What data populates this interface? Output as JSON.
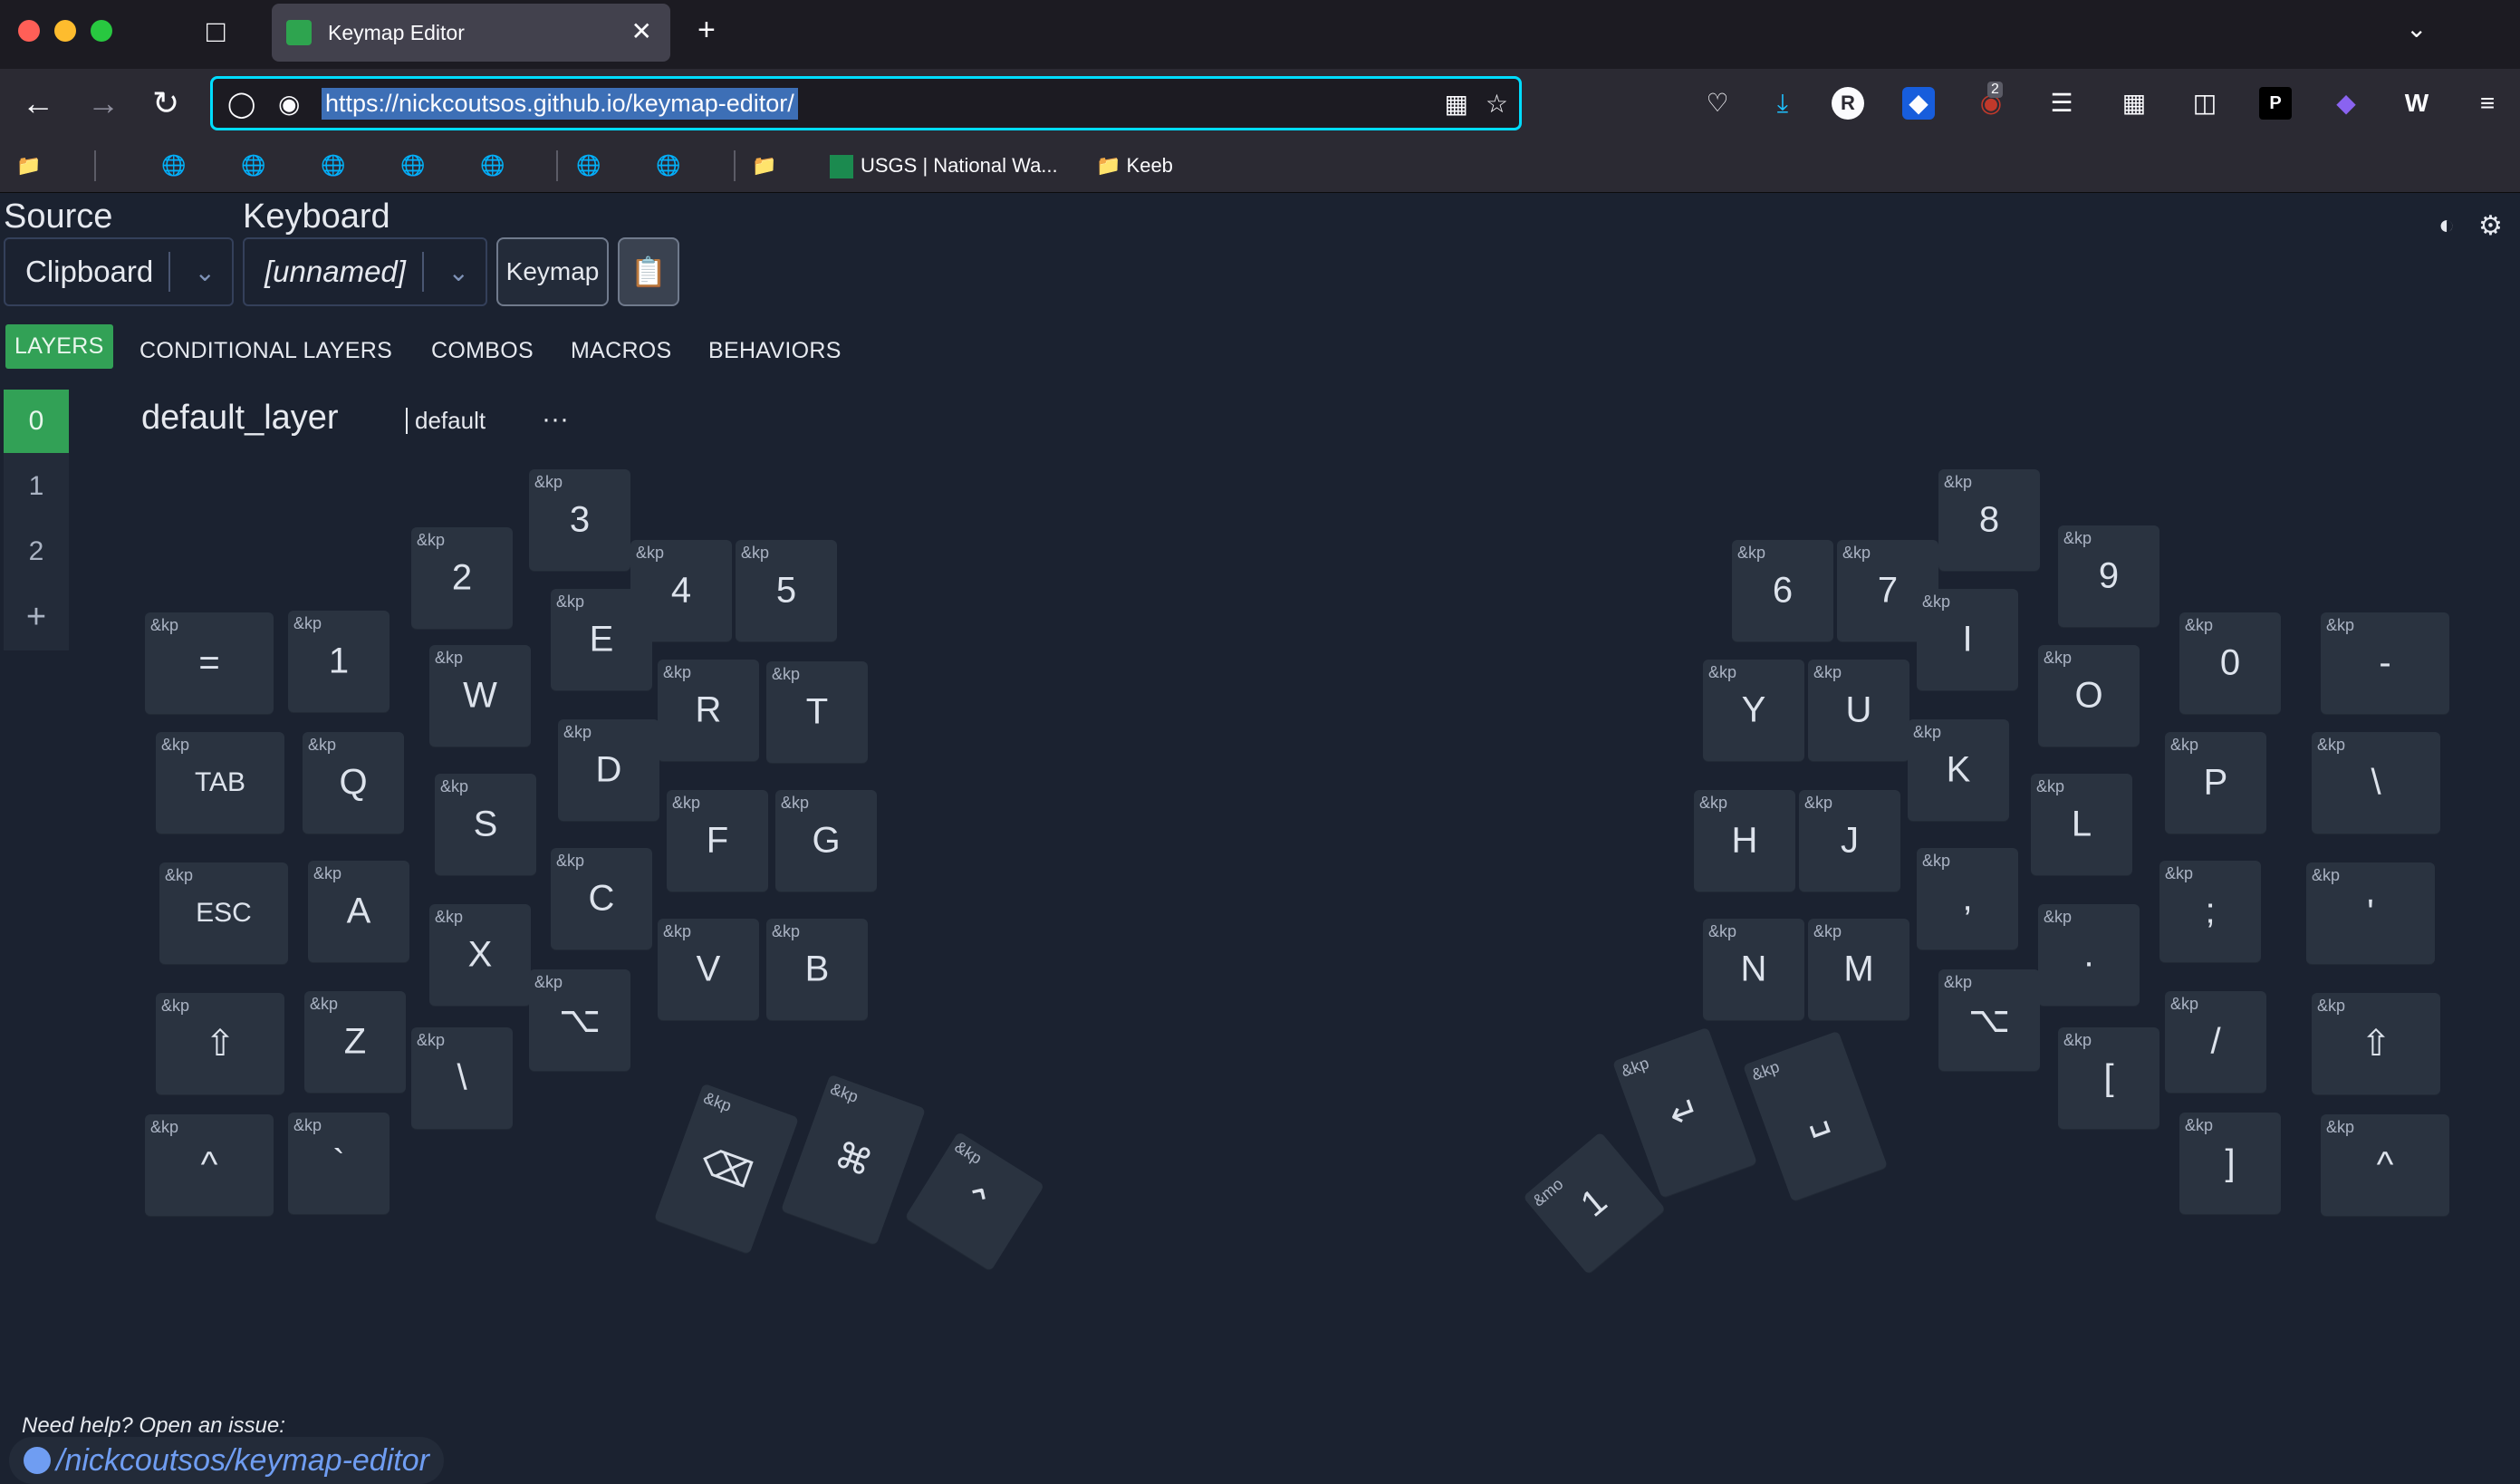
{
  "browser": {
    "tab_title": "Keymap Editor",
    "url": "https://nickcoutsos.github.io/keymap-editor/",
    "ext_badge": "2",
    "bookmarks": [
      {
        "label": "USGS | National Wa..."
      },
      {
        "label": "Keeb"
      }
    ]
  },
  "app": {
    "source_label": "Source",
    "source_value": "Clipboard",
    "keyboard_label": "Keyboard",
    "keyboard_value": "[unnamed]",
    "keymap_button": "Keymap",
    "nav_tabs": [
      "LAYERS",
      "CONDITIONAL LAYERS",
      "COMBOS",
      "MACROS",
      "BEHAVIORS"
    ],
    "layers": [
      "0",
      "1",
      "2"
    ],
    "add_layer": "+",
    "layer_name": "default_layer",
    "layer_tag": "default",
    "layer_menu": "···"
  },
  "keys": [
    {
      "b": "&kp",
      "p": "="
    },
    {
      "b": "&kp",
      "p": "1"
    },
    {
      "b": "&kp",
      "p": "2"
    },
    {
      "b": "&kp",
      "p": "3"
    },
    {
      "b": "&kp",
      "p": "4"
    },
    {
      "b": "&kp",
      "p": "5"
    },
    {
      "b": "&kp",
      "p": "TAB"
    },
    {
      "b": "&kp",
      "p": "Q"
    },
    {
      "b": "&kp",
      "p": "W"
    },
    {
      "b": "&kp",
      "p": "E"
    },
    {
      "b": "&kp",
      "p": "R"
    },
    {
      "b": "&kp",
      "p": "T"
    },
    {
      "b": "&kp",
      "p": "ESC"
    },
    {
      "b": "&kp",
      "p": "A"
    },
    {
      "b": "&kp",
      "p": "S"
    },
    {
      "b": "&kp",
      "p": "D"
    },
    {
      "b": "&kp",
      "p": "F"
    },
    {
      "b": "&kp",
      "p": "G"
    },
    {
      "b": "&kp",
      "p": "⇧"
    },
    {
      "b": "&kp",
      "p": "Z"
    },
    {
      "b": "&kp",
      "p": "X"
    },
    {
      "b": "&kp",
      "p": "C"
    },
    {
      "b": "&kp",
      "p": "V"
    },
    {
      "b": "&kp",
      "p": "B"
    },
    {
      "b": "&kp",
      "p": "^"
    },
    {
      "b": "&kp",
      "p": "`"
    },
    {
      "b": "&kp",
      "p": "\\"
    },
    {
      "b": "&kp",
      "p": "⌥"
    },
    {
      "b": "&kp",
      "p": "⌫"
    },
    {
      "b": "&kp",
      "p": "⌘"
    },
    {
      "b": "&kp",
      "p": "⌃"
    },
    {
      "b": "&kp",
      "p": "6"
    },
    {
      "b": "&kp",
      "p": "7"
    },
    {
      "b": "&kp",
      "p": "8"
    },
    {
      "b": "&kp",
      "p": "9"
    },
    {
      "b": "&kp",
      "p": "0"
    },
    {
      "b": "&kp",
      "p": "-"
    },
    {
      "b": "&kp",
      "p": "Y"
    },
    {
      "b": "&kp",
      "p": "U"
    },
    {
      "b": "&kp",
      "p": "I"
    },
    {
      "b": "&kp",
      "p": "O"
    },
    {
      "b": "&kp",
      "p": "P"
    },
    {
      "b": "&kp",
      "p": "\\"
    },
    {
      "b": "&kp",
      "p": "H"
    },
    {
      "b": "&kp",
      "p": "J"
    },
    {
      "b": "&kp",
      "p": "K"
    },
    {
      "b": "&kp",
      "p": "L"
    },
    {
      "b": "&kp",
      "p": ";"
    },
    {
      "b": "&kp",
      "p": "'"
    },
    {
      "b": "&kp",
      "p": "N"
    },
    {
      "b": "&kp",
      "p": "M"
    },
    {
      "b": "&kp",
      "p": ","
    },
    {
      "b": "&kp",
      "p": "."
    },
    {
      "b": "&kp",
      "p": "/"
    },
    {
      "b": "&kp",
      "p": "⇧"
    },
    {
      "b": "&kp",
      "p": "⌥"
    },
    {
      "b": "&kp",
      "p": "["
    },
    {
      "b": "&kp",
      "p": "]"
    },
    {
      "b": "&kp",
      "p": "^"
    },
    {
      "b": "&mo",
      "p": "1"
    },
    {
      "b": "&kp",
      "p": "↵"
    },
    {
      "b": "&kp",
      "p": "␣"
    }
  ],
  "footer": {
    "help": "Need help? Open an issue:",
    "repo": "/nickcoutsos/keymap-editor"
  }
}
